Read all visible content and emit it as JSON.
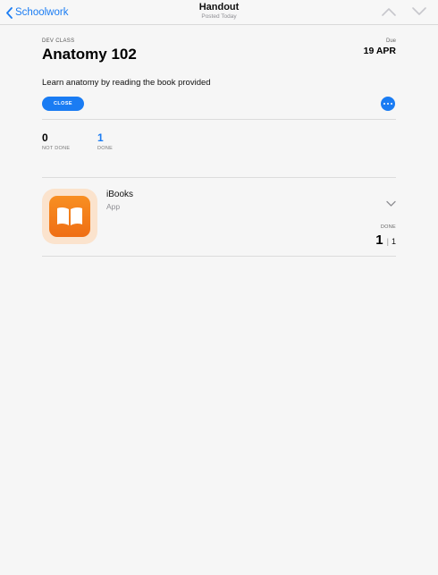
{
  "navbar": {
    "back_label": "Schoolwork",
    "title": "Handout",
    "subtitle": "Posted Today"
  },
  "assignment": {
    "class_label": "DEV CLASS",
    "title": "Anatomy 102",
    "due_label": "Due",
    "due_date": "19 APR",
    "description": "Learn anatomy by reading the book provided",
    "close_label": "CLOSE"
  },
  "stats": {
    "not_done_value": "0",
    "not_done_label": "NOT DONE",
    "done_value": "1",
    "done_label": "DONE"
  },
  "activity": {
    "name": "iBooks",
    "type": "App",
    "done_label": "DONE",
    "done_count": "1",
    "separator": "|",
    "total": "1"
  },
  "colors": {
    "accent": "#1a7cf3",
    "icon_orange": "#f57f1d",
    "icon_bg": "#fbe3cd"
  }
}
